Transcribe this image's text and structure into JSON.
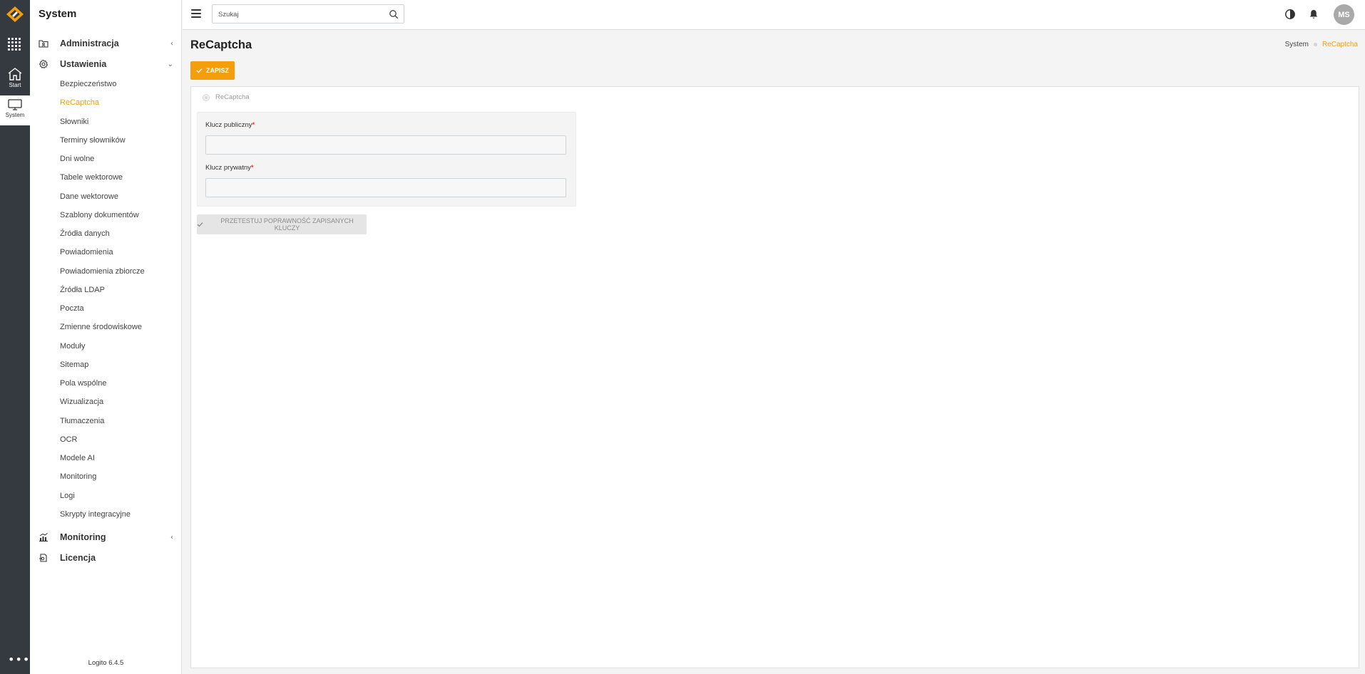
{
  "sidebar": {
    "title": "System",
    "groups": [
      {
        "label": "Administracja",
        "icon": "folder-user-icon",
        "expanded": false
      },
      {
        "label": "Ustawienia",
        "icon": "gear-icon",
        "expanded": true
      },
      {
        "label": "Monitoring",
        "icon": "chart-icon",
        "expanded": false
      },
      {
        "label": "Licencja",
        "icon": "license-icon",
        "expanded": false
      }
    ],
    "items": [
      "Bezpieczeństwo",
      "ReCaptcha",
      "Słowniki",
      "Terminy słowników",
      "Dni wolne",
      "Tabele wektorowe",
      "Dane wektorowe",
      "Szablony dokumentów",
      "Źródła danych",
      "Powiadomienia",
      "Powiadomienia zbiorcze",
      "Źródła LDAP",
      "Poczta",
      "Zmienne środowiskowe",
      "Moduły",
      "Sitemap",
      "Pola wspólne",
      "Wizualizacja",
      "Tłumaczenia",
      "OCR",
      "Modele AI",
      "Monitoring",
      "Logi",
      "Skrypty integracyjne"
    ],
    "active_item": "ReCaptcha",
    "version": "Logito 6.4.5"
  },
  "rail": {
    "start_label": "Start",
    "system_label": "System",
    "more_label": "•••"
  },
  "topbar": {
    "search_placeholder": "Szukaj",
    "avatar_initials": "MS"
  },
  "page": {
    "title": "ReCaptcha",
    "breadcrumb": {
      "root": "System",
      "current": "ReCaptcha"
    },
    "save_label": "ZAPISZ"
  },
  "form": {
    "radio_label": "ReCaptcha",
    "public_key_label": "Klucz publiczny",
    "public_key_value": "",
    "private_key_label": "Klucz prywatny",
    "private_key_value": "",
    "required_mark": "*",
    "test_button_label": "PRZETESTUJ POPRAWNOŚĆ ZAPISANYCH KLUCZY"
  },
  "colors": {
    "accent": "#f59e0b",
    "rail_bg": "#343a40",
    "required": "#e53935"
  }
}
